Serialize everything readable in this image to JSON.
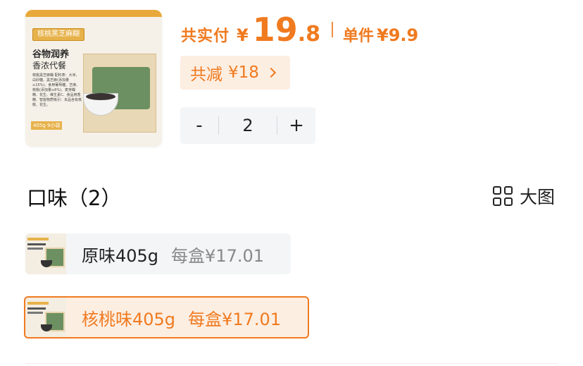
{
  "product": {
    "image_icon": "product-box-image",
    "box_name": "核桃黑芝麻糊",
    "box_line1": "谷物润养",
    "box_line2": "香浓代餐",
    "box_small": "核桃黑芝麻糊 配料表：大米、白砂糖、黑芝麻(添加量≥15%)、食用葡萄糖、芝麻、核桃(添加量≥6%)、麦芽糊精、花生、维生素C、食品用香精、智能物质吸引：本品含有核桃、花生。",
    "box_weight": "405g 9小袋"
  },
  "price": {
    "total_label": "共实付",
    "yen": "¥",
    "total_int": "19",
    "total_dec": ".8",
    "unit_label": "单件",
    "unit_price": "¥9.9",
    "color": "#f07a1f"
  },
  "discount": {
    "label": "共减",
    "value": "¥18",
    "icon": "chevron-right-icon"
  },
  "stepper": {
    "minus": "-",
    "value": "2",
    "plus": "+"
  },
  "flavor": {
    "title": "口味（2）",
    "bigview_label": "大图",
    "bigview_icon": "grid-icon"
  },
  "variants": [
    {
      "name": "原味405g",
      "price": "每盒¥17.01",
      "selected": false
    },
    {
      "name": "核桃味405g",
      "price": "每盒¥17.01",
      "selected": true
    }
  ]
}
